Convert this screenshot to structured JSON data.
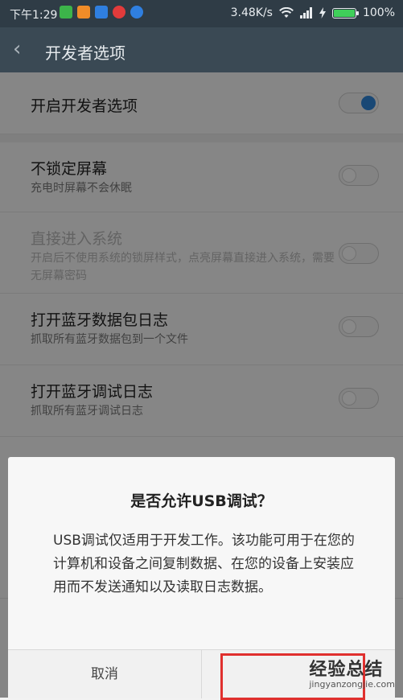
{
  "status_bar": {
    "time": "下午1:29",
    "speed": "3.48K/s",
    "battery": "100%",
    "app_icons": [
      {
        "name": "green-app-icon",
        "color": "#3cb44a"
      },
      {
        "name": "orange-app-icon",
        "color": "#f08c28"
      },
      {
        "name": "blue-app-icon",
        "color": "#2f7fe0"
      },
      {
        "name": "red-app-icon",
        "color": "#e23b3b"
      },
      {
        "name": "browser-app-icon",
        "color": "#2f7fe0"
      }
    ]
  },
  "toolbar": {
    "title": "开发者选项"
  },
  "settings": {
    "developer_toggle": {
      "label": "开启开发者选项",
      "on": true
    },
    "items": [
      {
        "title": "不锁定屏幕",
        "subtitle": "充电时屏幕不会休眠",
        "disabled": false
      },
      {
        "title": "直接进入系统",
        "subtitle": "开启后不使用系统的锁屏样式，点亮屏幕直接进入系统，需要无屏幕密码",
        "disabled": true
      },
      {
        "title": "打开蓝牙数据包日志",
        "subtitle": "抓取所有蓝牙数据包到一个文件",
        "disabled": false
      },
      {
        "title": "打开蓝牙调试日志",
        "subtitle": "抓取所有蓝牙调试日志",
        "disabled": false
      }
    ]
  },
  "dialog": {
    "title": "是否允许USB调试？",
    "message": "USB调试仅适用于开发工作。该功能可用于在您的计算机和设备之间复制数据、在您的设备上安装应用而不发送通知以及读取日志数据。",
    "cancel_label": "取消"
  },
  "watermark": {
    "main": "经验总结",
    "sub": "jingyanzongjie.com"
  },
  "colors": {
    "accent": "#2f84d6",
    "highlight_box": "#e0302e"
  }
}
